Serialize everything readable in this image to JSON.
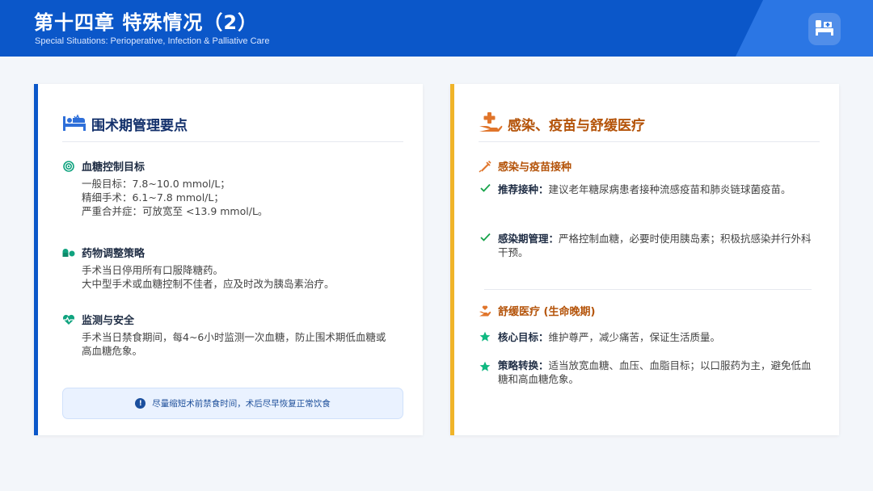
{
  "header": {
    "title": "第十四章 特殊情况（2）",
    "subtitle": "Special Situations: Perioperative, Infection & Palliative Care",
    "logo_icon": "hospital-bed-icon"
  },
  "left_card": {
    "title": "围术期管理要点",
    "title_icon": "hospital-bed-icon",
    "sections": [
      {
        "icon": "target-icon",
        "title": "血糖控制目标",
        "lines": [
          "一般目标：7.8~10.0 mmol/L；",
          "精细手术：6.1~7.8 mmol/L；",
          "严重合并症：可放宽至 <13.9 mmol/L。"
        ]
      },
      {
        "icon": "pills-icon",
        "title": "药物调整策略",
        "lines": [
          "手术当日停用所有口服降糖药。",
          "大中型手术或血糖控制不佳者，应及时改为胰岛素治疗。"
        ]
      },
      {
        "icon": "heartbeat-icon",
        "title": "监测与安全",
        "lines": [
          "手术当日禁食期间，每4~6小时监测一次血糖，防止围术期低血糖或",
          "高血糖危象。"
        ]
      }
    ],
    "note": "尽量缩短术前禁食时间，术后尽早恢复正常饮食"
  },
  "right_card": {
    "title": "感染、疫苗与舒缓医疗",
    "title_icon": "hand-medical-icon",
    "infection": {
      "title": "感染与疫苗接种",
      "items": [
        {
          "label": "推荐接种：",
          "text": "建议老年糖尿病患者接种流感疫苗和肺炎链球菌疫苗。"
        },
        {
          "label": "感染期管理：",
          "text": "严格控制血糖，必要时使用胰岛素；积极抗感染并行外科干预。"
        }
      ]
    },
    "palliative": {
      "title": "舒缓医疗 (生命晚期)",
      "items": [
        {
          "label": "核心目标：",
          "text": "维护尊严，减少痛苦，保证生活质量。"
        },
        {
          "label": "策略转换：",
          "text": "适当放宽血糖、血压、血脂目标；以口服药为主，避免低血糖和高血糖危象。"
        }
      ]
    }
  },
  "colors": {
    "primary": "#0b57c9",
    "accent": "#f0b429",
    "orange_text": "#b45309",
    "check": "#16a34a",
    "star": "#10b981"
  }
}
